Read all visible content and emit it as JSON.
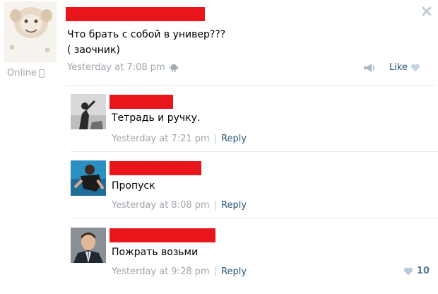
{
  "post": {
    "text_lines": [
      "Что брать с собой в универ???",
      "( заочник)"
    ],
    "online_label": "Online",
    "timestamp": "Yesterday at 7:08 pm",
    "like_label": "Like",
    "colors": {
      "redaction": "#e8151b",
      "link": "#2b587a",
      "meta": "#a0a6ad"
    }
  },
  "comments": [
    {
      "text": "Тетрадь и ручку.",
      "timestamp": "Yesterday at 7:21 pm",
      "separator": "|",
      "reply_label": "Reply"
    },
    {
      "text": "Пропуск",
      "timestamp": "Yesterday at 8:08 pm",
      "separator": "|",
      "reply_label": "Reply"
    },
    {
      "text": "Пожрать возьми",
      "timestamp": "Yesterday at 9:28 pm",
      "separator": "|",
      "reply_label": "Reply",
      "like_count": "10"
    }
  ]
}
